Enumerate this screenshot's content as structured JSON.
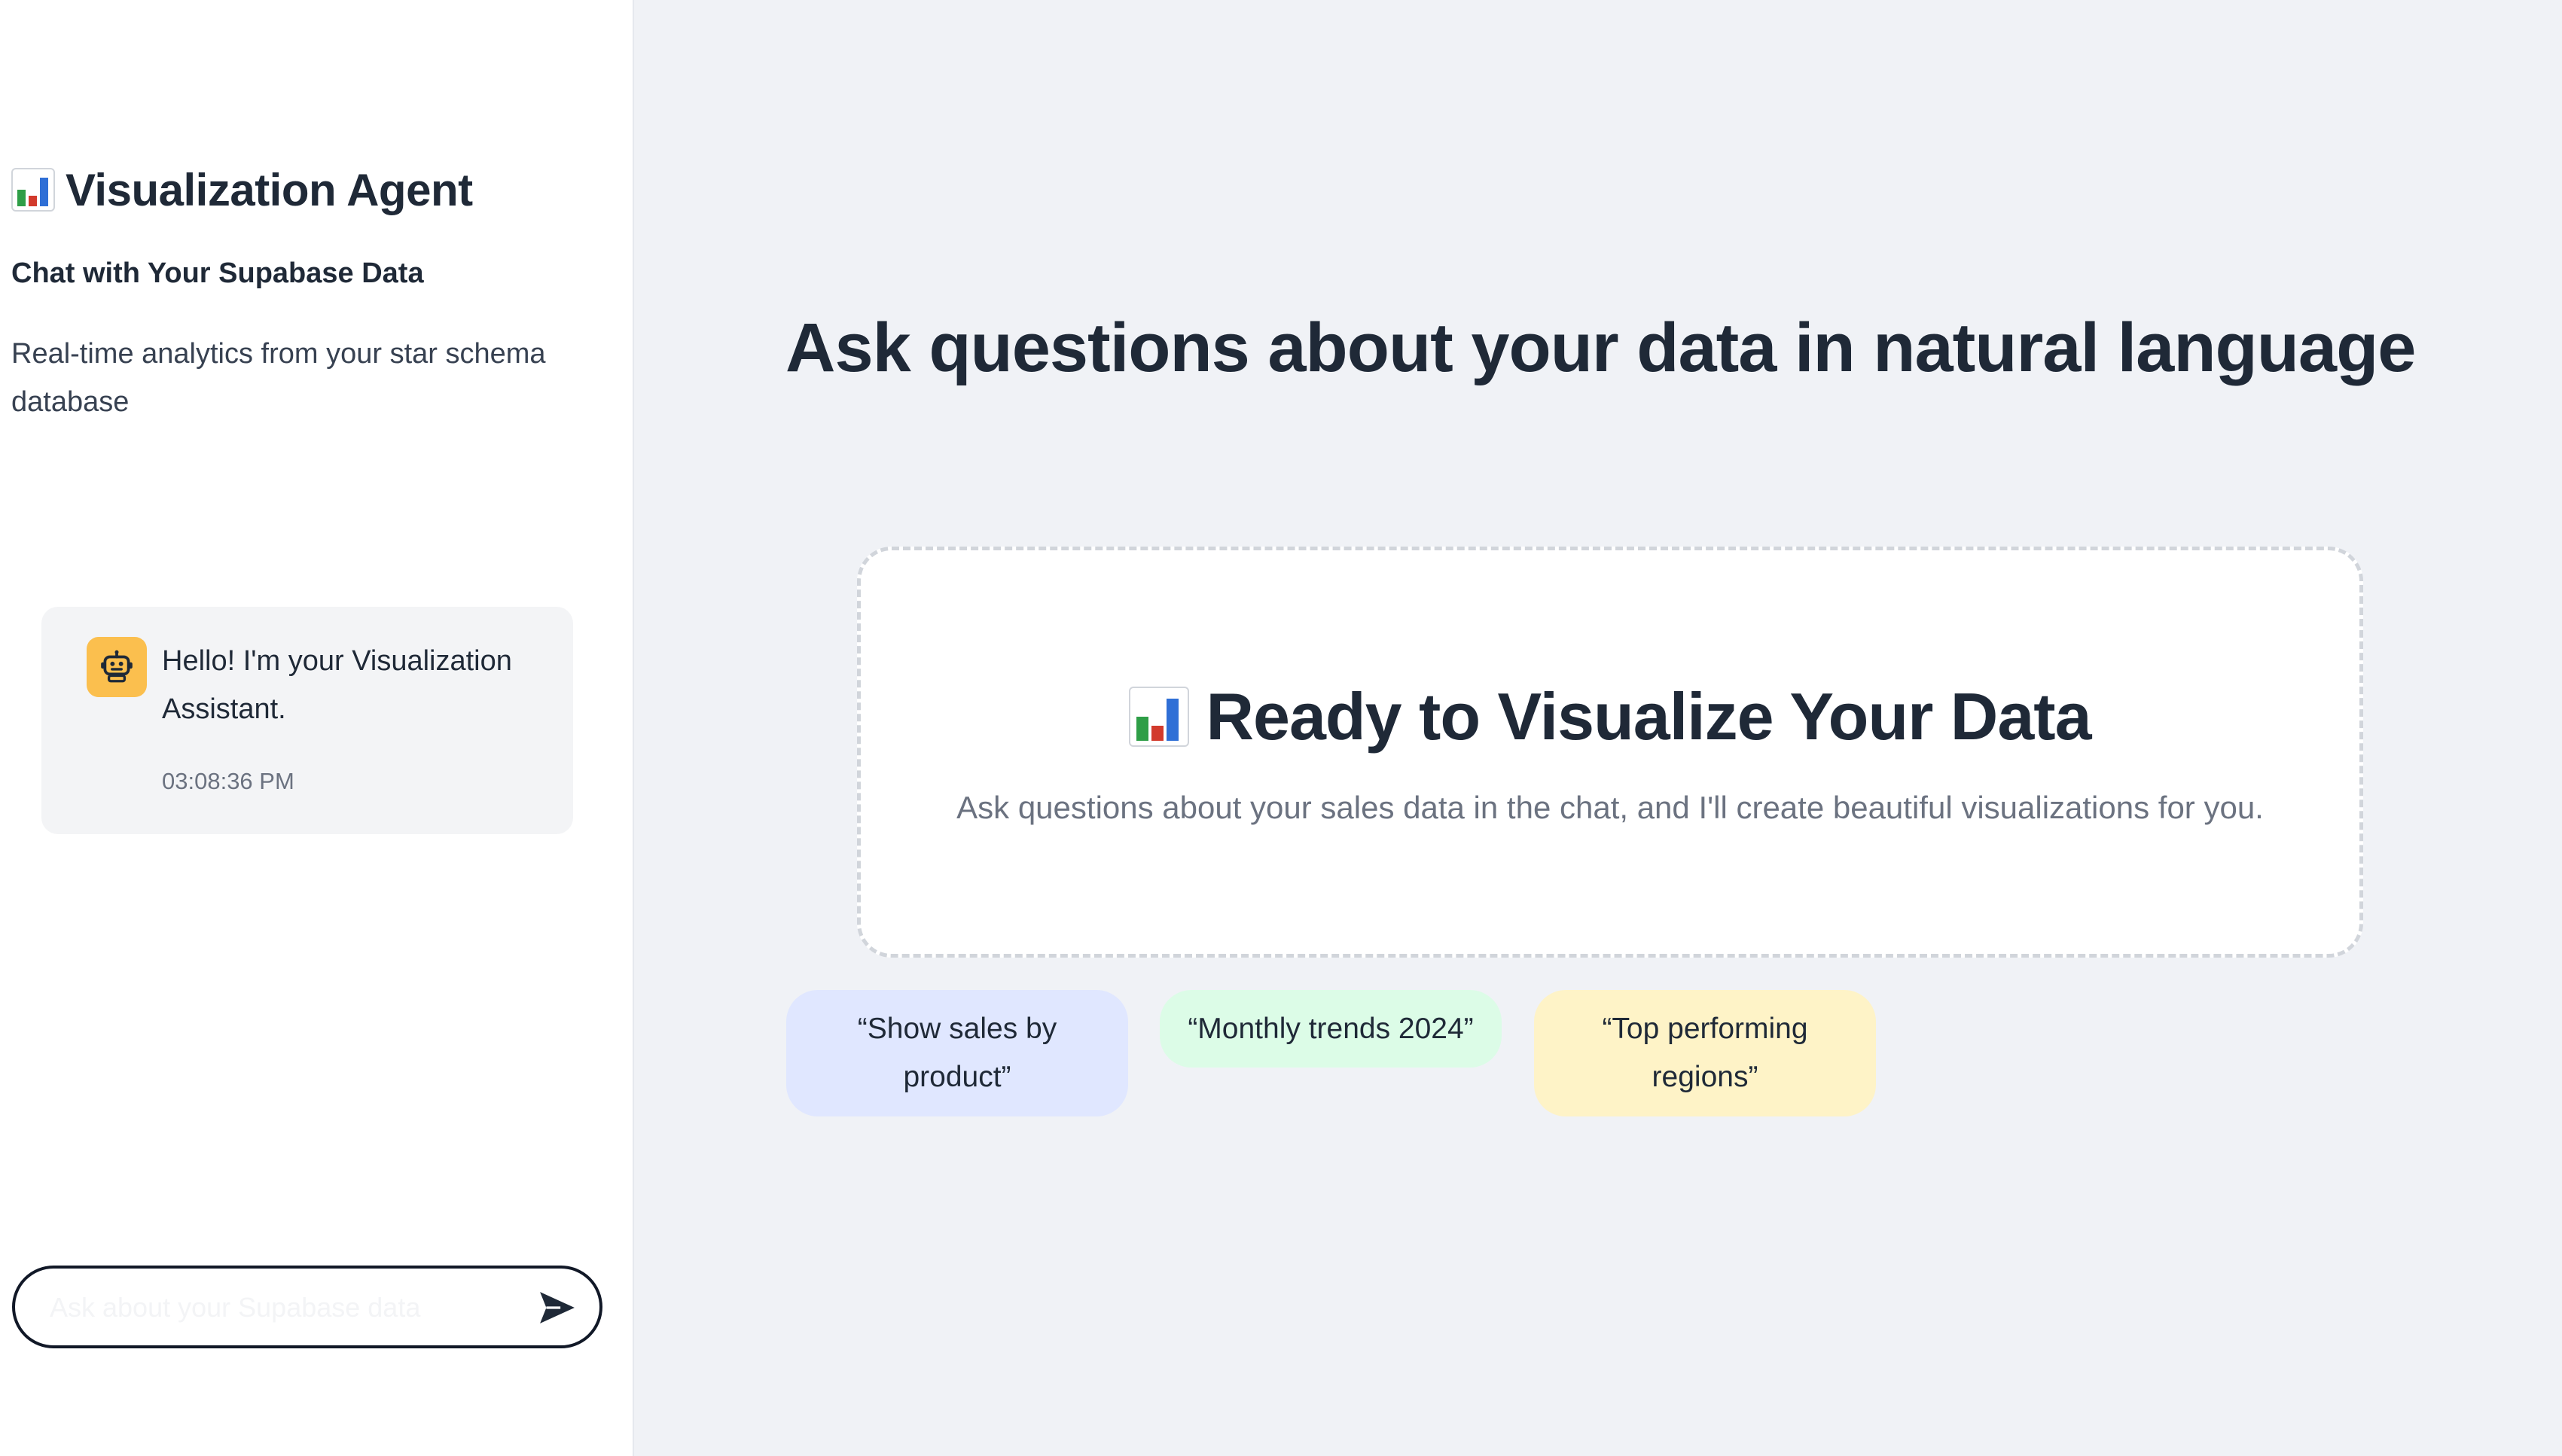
{
  "sidebar": {
    "title": "Visualization Agent",
    "title_icon": "bar-chart-icon",
    "subtitle": "Chat with Your Supabase Data",
    "description": "Real-time analytics from your star schema database",
    "messages": [
      {
        "role": "assistant",
        "avatar_icon": "robot-icon",
        "text": "Hello! I'm your Visualization Assistant.",
        "time": "03:08:36 PM"
      }
    ],
    "chat_input": {
      "value": "",
      "placeholder": "Ask about your Supabase data",
      "send_icon": "send-icon"
    }
  },
  "main": {
    "heading": "Ask questions about your data in natural language",
    "empty_state": {
      "icon": "bar-chart-icon",
      "title": "Ready to Visualize Your Data",
      "description": "Ask questions about your sales data in the chat, and I'll create beautiful visualizations for you."
    },
    "suggestions": [
      {
        "label": "“Show sales by product”",
        "color": "#e0e7ff"
      },
      {
        "label": "“Monthly trends 2024”",
        "color": "#dcfce7"
      },
      {
        "label": "“Top performing regions”",
        "color": "#fef3c7"
      }
    ]
  },
  "colors": {
    "main_bg": "#f0f2f6",
    "sidebar_bg": "#ffffff",
    "avatar_bg": "#fbbf4e",
    "text_primary": "#1f2937",
    "text_muted": "#6b7280"
  }
}
